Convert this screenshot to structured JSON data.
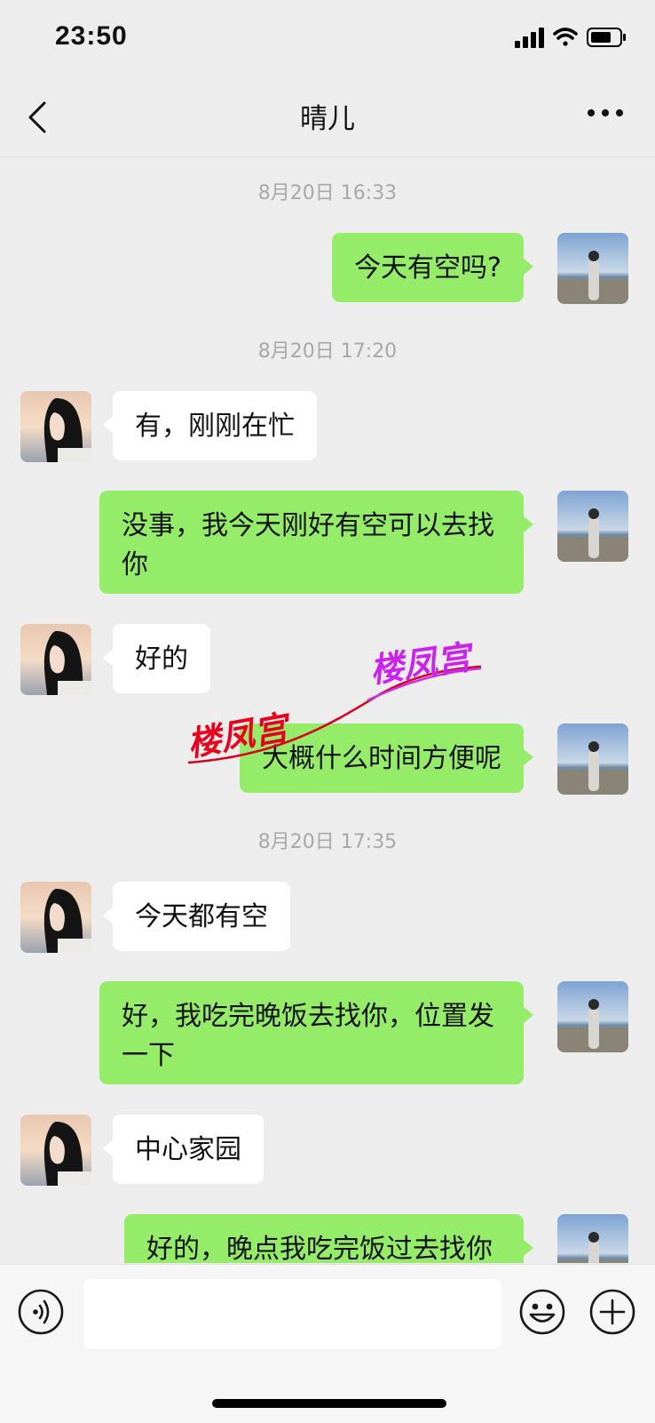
{
  "status_bar": {
    "time": "23:50"
  },
  "header": {
    "title": "晴儿"
  },
  "messages": [
    {
      "type": "time",
      "text": "8月20日 16:33"
    },
    {
      "type": "msg",
      "from": "me",
      "text": "今天有空吗?"
    },
    {
      "type": "time",
      "text": "8月20日 17:20"
    },
    {
      "type": "msg",
      "from": "other",
      "text": "有，刚刚在忙"
    },
    {
      "type": "msg",
      "from": "me",
      "text": "没事，我今天刚好有空可以去找你"
    },
    {
      "type": "msg",
      "from": "other",
      "text": "好的"
    },
    {
      "type": "msg",
      "from": "me",
      "text": "大概什么时间方便呢"
    },
    {
      "type": "time",
      "text": "8月20日 17:35"
    },
    {
      "type": "msg",
      "from": "other",
      "text": "今天都有空"
    },
    {
      "type": "msg",
      "from": "me",
      "text": "好，我吃完晚饭去找你，位置发一下"
    },
    {
      "type": "msg",
      "from": "other",
      "text": "中心家园"
    },
    {
      "type": "msg",
      "from": "me",
      "text": "好的，晚点我吃完饭过去找你"
    }
  ],
  "watermark": {
    "text": "楼凤宫"
  },
  "colors": {
    "background": "#ededed",
    "my_bubble": "#95ec69",
    "other_bubble": "#ffffff"
  },
  "icons": {
    "back": "chevron-left-icon",
    "more": "more-dots-icon",
    "voice": "voice-icon",
    "emoji": "emoji-icon",
    "add": "plus-icon"
  }
}
